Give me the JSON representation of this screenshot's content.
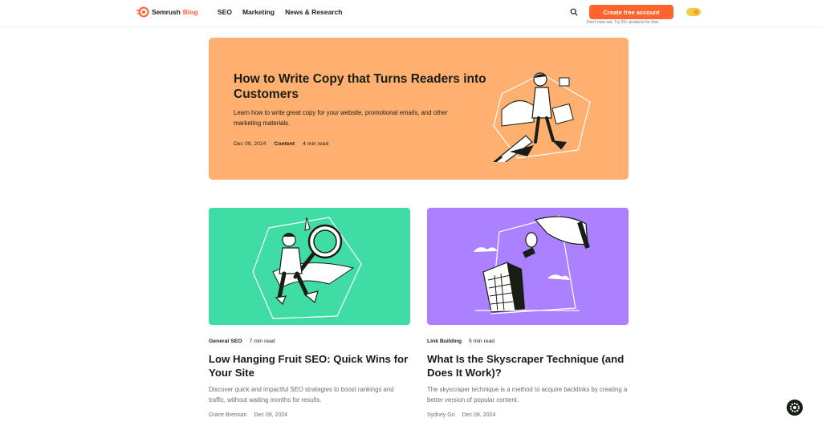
{
  "header": {
    "logo_text": "Semrush",
    "logo_suffix": "Blog",
    "nav": [
      "SEO",
      "Marketing",
      "News & Research"
    ],
    "cta_label": "Create free account",
    "cta_sub": "Don't miss out. Try 55+ products for free."
  },
  "featured": {
    "title": "How to Write Copy that Turns Readers into Customers",
    "description": "Learn how to write great copy for your website, promotional emails, and other marketing materials.",
    "date": "Dec 09, 2024",
    "category": "Content",
    "read_time": "4 min read"
  },
  "cards": [
    {
      "category": "General SEO",
      "read_time": "7 min read",
      "title": "Low Hanging Fruit SEO: Quick Wins for Your Site",
      "description": "Discover quick and impactful SEO strategies to boost rankings and traffic, without waiting months for results.",
      "author": "Grace Brennan",
      "date": "Dec 09, 2024"
    },
    {
      "category": "Link Building",
      "read_time": "5 min read",
      "title": "What Is the Skyscraper Technique (and Does It Work)?",
      "description": "The skyscraper technique is a method to acquire backlinks by creating a better version of popular content.",
      "author": "Sydney Go",
      "date": "Dec 09, 2024"
    }
  ],
  "colors": {
    "brand": "#ff642d",
    "featured_bg": "#ffb071",
    "card1_bg": "#40dca5",
    "card2_bg": "#ac81ff"
  },
  "icons": [
    "semrush-logo-icon",
    "search-icon",
    "theme-toggle-icon",
    "settings-gear-icon"
  ]
}
